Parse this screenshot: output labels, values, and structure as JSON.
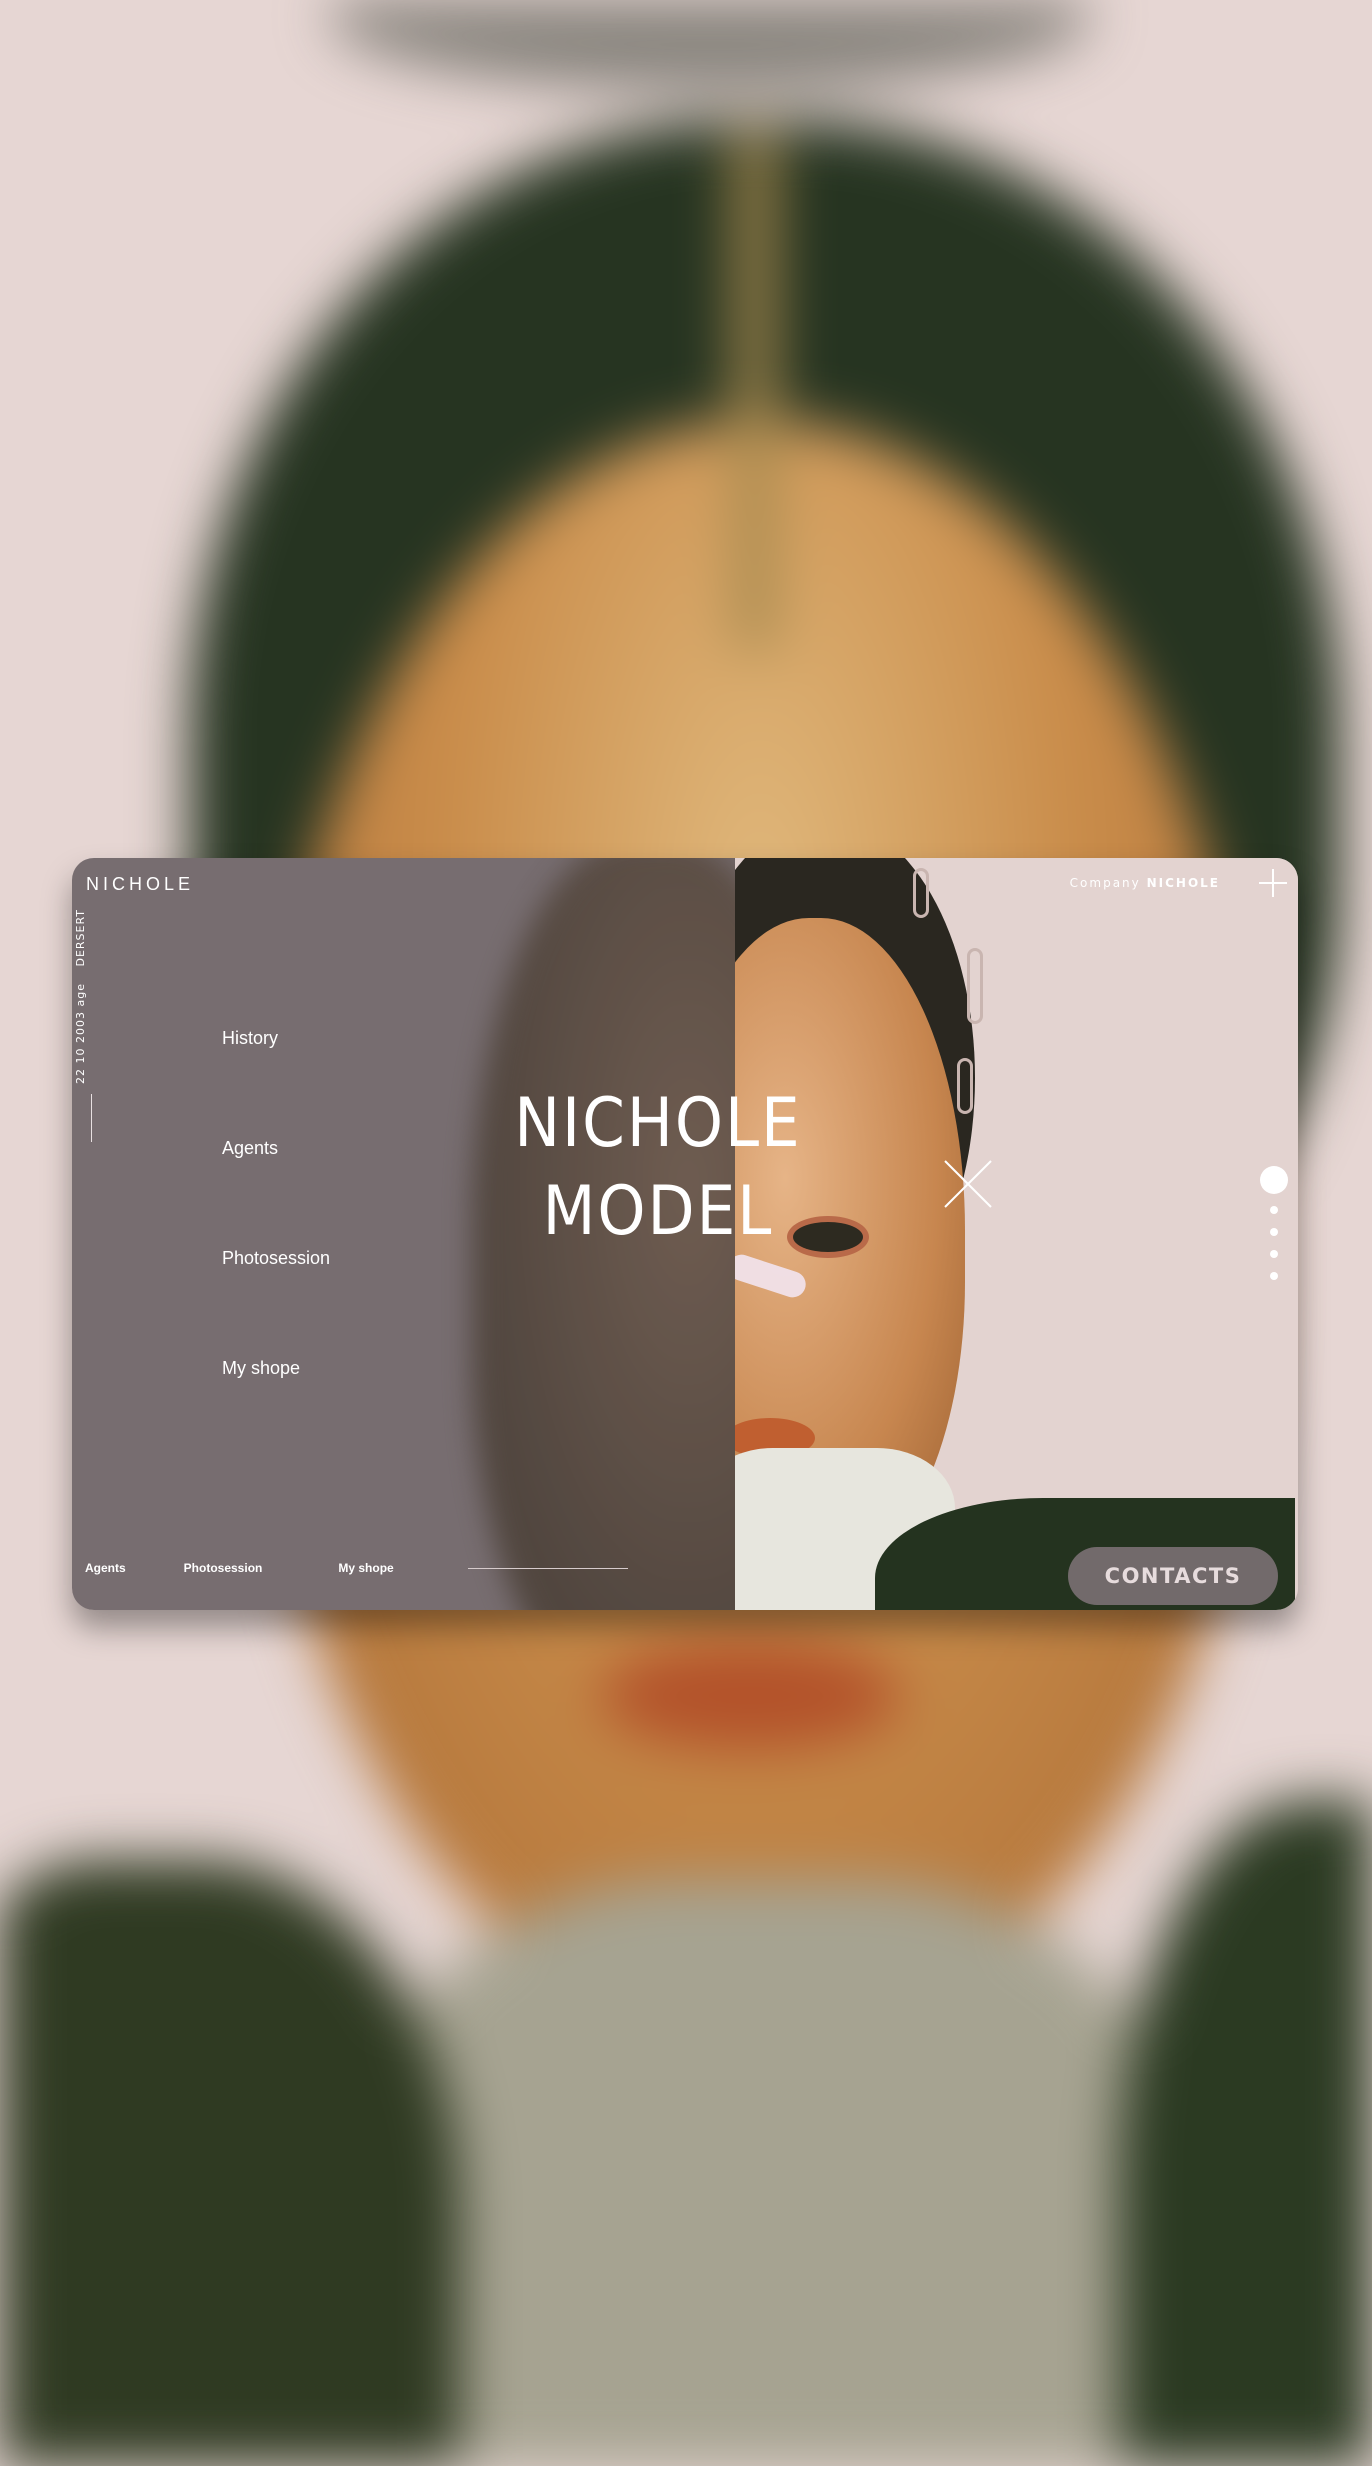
{
  "brand": {
    "logo": "NICHOLE"
  },
  "side_info": {
    "birth": "22 10 2003 age",
    "origin": "DERSERT"
  },
  "menu": {
    "items": [
      "History",
      "Agents",
      "Photosession",
      "My shope"
    ]
  },
  "hero": {
    "line1": "NICHOLE",
    "line2": "MODEL"
  },
  "header": {
    "company_label": "Company",
    "company_name": "NICHOLE"
  },
  "bottom_nav": {
    "items": [
      "Agents",
      "Photosession",
      "My shope"
    ]
  },
  "cta": {
    "contacts_label": "CONTACTS"
  },
  "pagination": {
    "total": 5,
    "active": 1
  },
  "icons": {
    "plus": "plus-icon",
    "close": "close-icon"
  },
  "colors": {
    "left_panel": "#776d70",
    "background": "#e6d6d3",
    "button": "#726a6b",
    "text": "#ffffff"
  }
}
